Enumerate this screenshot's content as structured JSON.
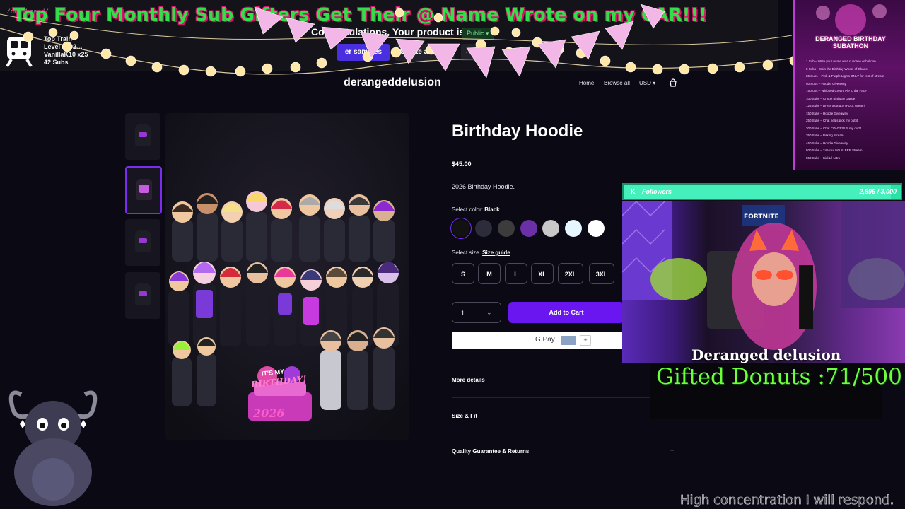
{
  "browser": {
    "url_fragment": "…/dashboard/…"
  },
  "ticker": {
    "text": "Top Four Monthly Sub Gifters Get Their @ Name Wrote on my CAR!!!"
  },
  "top_goal": {
    "line1": "Top Train",
    "line2": "Level 4  (92…",
    "line3": "VanillaK10 x25",
    "line4": "42 Subs"
  },
  "publish_bar": {
    "congrats": "Congratulations. Your product is",
    "visibility": "Public",
    "order_samples": "er samples",
    "create_another": "Create another",
    "more": "···"
  },
  "store": {
    "name": "derangeddelusion",
    "nav_home": "Home",
    "nav_browse": "Browse all",
    "nav_currency": "USD"
  },
  "artwork": {
    "caption": "IT'S MY",
    "headline": "BIRTHDAY!",
    "year": "2026"
  },
  "product": {
    "title": "Birthday Hoodie",
    "price": "$45.00",
    "description": "2026 Birthday Hoodie.",
    "color_label": "Select color:",
    "color_value": "Black",
    "colors": [
      "#121212",
      "#2c2c3a",
      "#3c3c3c",
      "#6b2fa8",
      "#c8c8c8",
      "#e6f6ff",
      "#ffffff"
    ],
    "size_label": "Select size",
    "size_guide": "Size guide",
    "sizes": [
      "S",
      "M",
      "L",
      "XL",
      "2XL",
      "3XL"
    ],
    "quantity": "1",
    "add_to_cart": "Add to Cart",
    "gpay": "G Pay",
    "gpay_add": "+",
    "more_details": "More details",
    "size_fit": "Size & Fit",
    "quality": "Quality Guarantee & Returns",
    "accent": "#6a16f0"
  },
  "subathon": {
    "title_line1": "DERANGED BIRTHDAY",
    "title_line2": "SUBATHON",
    "rows": [
      "1 Sub – Write your name on a cupcake or balloon",
      "5 Subs – Spin the Birthday Wheel of Chaos",
      "25 Subs – Pink & Purple Lights ONLY for rest of stream",
      "50 Subs – Hoodie Giveaway",
      "75 Subs – Whipped Cream Pie to the Face",
      "100 Subs – Cringe Birthday Dance",
      "125 Subs – Dress as a guy (FULL stream)",
      "150 Subs – Hoodie Giveaway",
      "250 Subs – Chat helps pick my outfit",
      "300 Subs – Chat CONTROLS my outfit",
      "350 Subs – Baking Stream",
      "450 Subs – Hoodie Giveaway",
      "500 Subs – 24 Hour NO SLEEP Stream",
      "550 Subs – Kidi Lil Nitro"
    ]
  },
  "followers": {
    "label": "Followers",
    "count": "2,896 / 3,000",
    "progress": 0.965
  },
  "webcam": {
    "streamer_name": "Deranged delusion",
    "sign": "FORTNITE"
  },
  "donuts": {
    "text": "Gifted Donuts :71/500"
  },
  "status": {
    "text": "High concentration I will respond."
  }
}
